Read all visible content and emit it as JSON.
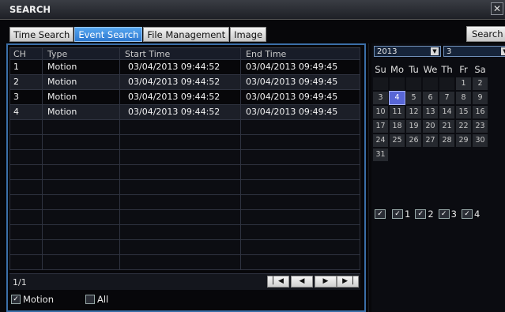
{
  "window": {
    "title": "SEARCH",
    "close_icon": "close-icon"
  },
  "tabs": [
    {
      "label": "Time Search",
      "active": false
    },
    {
      "label": "Event Search",
      "active": true
    },
    {
      "label": "File Management",
      "active": false
    },
    {
      "label": "Image",
      "active": false
    }
  ],
  "search_button": "Search",
  "table": {
    "columns": [
      "CH",
      "Type",
      "Start Time",
      "End Time"
    ],
    "rows": [
      [
        "1",
        "Motion",
        "03/04/2013 09:44:52",
        "03/04/2013 09:49:45"
      ],
      [
        "2",
        "Motion",
        "03/04/2013 09:44:52",
        "03/04/2013 09:49:45"
      ],
      [
        "3",
        "Motion",
        "03/04/2013 09:44:52",
        "03/04/2013 09:49:45"
      ],
      [
        "4",
        "Motion",
        "03/04/2013 09:44:52",
        "03/04/2013 09:49:45"
      ]
    ],
    "page": "1/1"
  },
  "pager_icons": [
    "first-page-icon",
    "prev-page-icon",
    "next-page-icon",
    "last-page-icon"
  ],
  "filters": [
    {
      "label": "Motion",
      "checked": true
    },
    {
      "label": "All",
      "checked": false
    }
  ],
  "calendar": {
    "year": "2013",
    "month": "3",
    "weekdays": [
      "Su",
      "Mo",
      "Tu",
      "We",
      "Th",
      "Fr",
      "Sa"
    ],
    "weeks": [
      [
        "",
        "",
        "",
        "",
        "",
        "1",
        "2"
      ],
      [
        "3",
        "4",
        "5",
        "6",
        "7",
        "8",
        "9"
      ],
      [
        "10",
        "11",
        "12",
        "13",
        "14",
        "15",
        "16"
      ],
      [
        "17",
        "18",
        "19",
        "20",
        "21",
        "22",
        "23"
      ],
      [
        "24",
        "25",
        "26",
        "27",
        "28",
        "29",
        "30"
      ],
      [
        "31",
        "",
        "",
        "",
        "",
        "",
        ""
      ]
    ],
    "selected_day": "4",
    "channels": [
      {
        "label": "",
        "checked": true
      },
      {
        "label": "1",
        "checked": true
      },
      {
        "label": "2",
        "checked": true
      },
      {
        "label": "3",
        "checked": true
      },
      {
        "label": "4",
        "checked": true
      }
    ]
  }
}
